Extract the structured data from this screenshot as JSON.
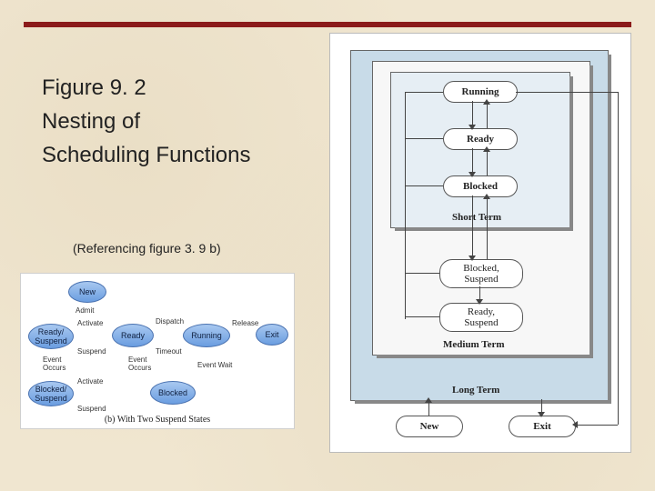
{
  "title": {
    "l1": "Figure 9. 2",
    "l2": "Nesting of",
    "l3": "Scheduling Functions"
  },
  "refnote": "(Referencing figure 3. 9 b)",
  "smallfig": {
    "caption": "(b) With Two Suspend States",
    "states": {
      "new": "New",
      "ready": "Ready",
      "running": "Running",
      "exit": "Exit",
      "blocked": "Blocked",
      "readySuspend": "Ready/\nSuspend",
      "blockedSuspend": "Blocked/\nSuspend"
    },
    "labels": {
      "admit": "Admit",
      "activate": "Activate",
      "suspend": "Suspend",
      "dispatch": "Dispatch",
      "timeout": "Timeout",
      "release": "Release",
      "eventOccurs": "Event\nOccurs",
      "eventWait": "Event Wait"
    }
  },
  "bigfig": {
    "layers": {
      "longTerm": "Long Term",
      "mediumTerm": "Medium Term",
      "shortTerm": "Short Term"
    },
    "states": {
      "running": "Running",
      "ready": "Ready",
      "blocked": "Blocked",
      "blockedSuspend": "Blocked,\nSuspend",
      "readySuspend": "Ready,\nSuspend",
      "new": "New",
      "exit": "Exit"
    }
  }
}
